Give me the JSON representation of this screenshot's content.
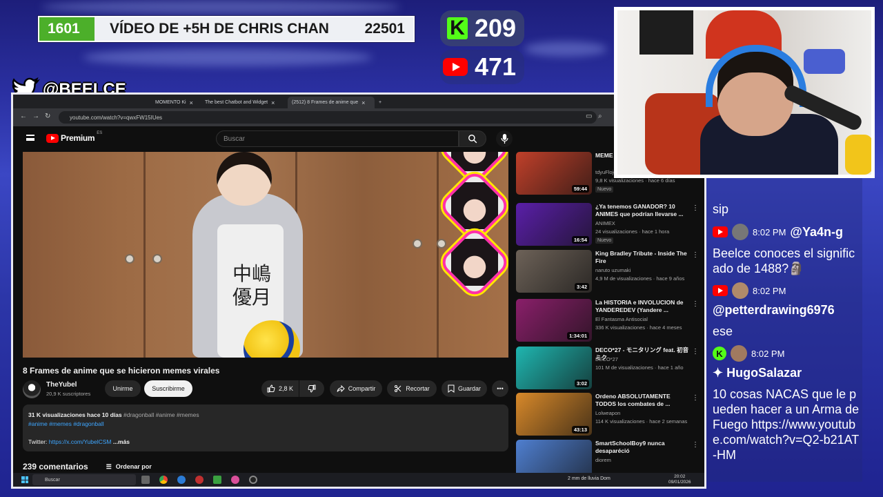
{
  "banner": {
    "left_count": "1601",
    "title": "VÍDEO DE +5H DE CHRIS CHAN",
    "right_count": "22501"
  },
  "counters": {
    "kick": "209",
    "youtube": "471"
  },
  "twitter": {
    "handle": "@BEELCE_"
  },
  "browser": {
    "tabs": [
      {
        "label": "MOMENTO Ki",
        "active": false
      },
      {
        "label": "The best Chatbot and Widget",
        "active": false
      },
      {
        "label": "(2512) 8 Frames de anime que",
        "active": true
      }
    ],
    "url": "youtube.com/watch?v=qwxFW15IUes"
  },
  "youtube": {
    "logo_word": "Premium",
    "logo_region": "ES",
    "search_placeholder": "Buscar",
    "video": {
      "title": "8 Frames de anime que se hicieron memes virales",
      "channel": "TheYubel",
      "subscribers": "20,9 K suscriptores",
      "join_label": "Unirme",
      "subscribe_label": "Suscribirme",
      "likes": "2,8 K",
      "share_label": "Compartir",
      "clip_label": "Recortar",
      "save_label": "Guardar",
      "description_meta": "31 K visualizaciones  hace 10 días",
      "description_meta_tags": "#dragonball #anime #memes",
      "description_tags": "#anime #memes #dragonball",
      "twitter_label": "Twitter:",
      "twitter_link": "https://x.com/YubelCSM",
      "more_label": "...más",
      "comments_count": "239 comentarios",
      "sort_label": "Ordenar por",
      "overlay_text_1": "中嶋",
      "overlay_text_2": "優月"
    },
    "related": [
      {
        "title": "MEME\nde ANI",
        "channel": "tdyuFlojo",
        "stats": "9,8 K visualizaciones · hace 6 días",
        "duration": "59:44",
        "badge": "Nuevo",
        "thumb_color": "#c0402a"
      },
      {
        "title": "¿Ya tenemos GANADOR? 10 ANIMES que podrían llevarse ...",
        "channel": "ANIMEX",
        "stats": "24 visualizaciones · hace 1 hora",
        "duration": "16:54",
        "badge": "Nuevo",
        "thumb_color": "#5a1fa8"
      },
      {
        "title": "King Bradley Tribute - Inside The Fire",
        "channel": "naruto uzumaki",
        "stats": "4,9 M de visualizaciones · hace 9 años",
        "duration": "3:42",
        "badge": "",
        "thumb_color": "#6d6258"
      },
      {
        "title": "La HISTORIA e INVOLUCION de YANDEREDEV (Yandere ...",
        "channel": "El Fantasma Antisocial",
        "stats": "336 K visualizaciones · hace 4 meses",
        "duration": "1:34:01",
        "badge": "",
        "thumb_color": "#8a1f6a"
      },
      {
        "title": "DECO*27 - モニタリング feat. 初音ミク",
        "channel": "DECO*27",
        "stats": "101 M de visualizaciones · hace 1 año",
        "duration": "3:02",
        "badge": "",
        "thumb_color": "#1fb6b0"
      },
      {
        "title": "Ordeno ABSOLUTAMENTE TODOS los combates de ...",
        "channel": "Lolweapon",
        "stats": "114 K visualizaciones · hace 2 semanas",
        "duration": "43:13",
        "badge": "",
        "thumb_color": "#d8892a"
      },
      {
        "title": "SmartSchoolBoy9 nunca desaparéció",
        "channel": "diorem",
        "stats": "",
        "duration": "",
        "badge": "",
        "thumb_color": "#4f7fd0"
      }
    ]
  },
  "taskbar": {
    "search_placeholder": "Buscar",
    "weather": "2 mm de lluvia Dom",
    "time": "20:02",
    "date": "09/01/2026"
  },
  "chat": {
    "messages": [
      {
        "type": "text",
        "text": "sip"
      },
      {
        "type": "head",
        "platform": "youtube",
        "time": "8:02 PM",
        "user": "@Ya4n-g"
      },
      {
        "type": "text",
        "text": "Beelce conoces el significado de 1488?🗿"
      },
      {
        "type": "head",
        "platform": "youtube",
        "time": "8:02 PM",
        "user": ""
      },
      {
        "type": "user",
        "text": "@petterdrawing6976"
      },
      {
        "type": "text",
        "text": "ese"
      },
      {
        "type": "head",
        "platform": "kick",
        "time": "8:02 PM",
        "user": ""
      },
      {
        "type": "user",
        "text": "✦ HugoSalazar"
      },
      {
        "type": "text",
        "text": "10 cosas NACAS que le pueden hacer a un Arma de Fuego https://www.youtube.com/watch?v=Q2-b21AT-HM"
      }
    ]
  },
  "colors": {
    "kick_green": "#53fc18",
    "youtube_red": "#ff0000",
    "banner_green": "#4caf2a",
    "link_blue": "#3ea6ff"
  }
}
